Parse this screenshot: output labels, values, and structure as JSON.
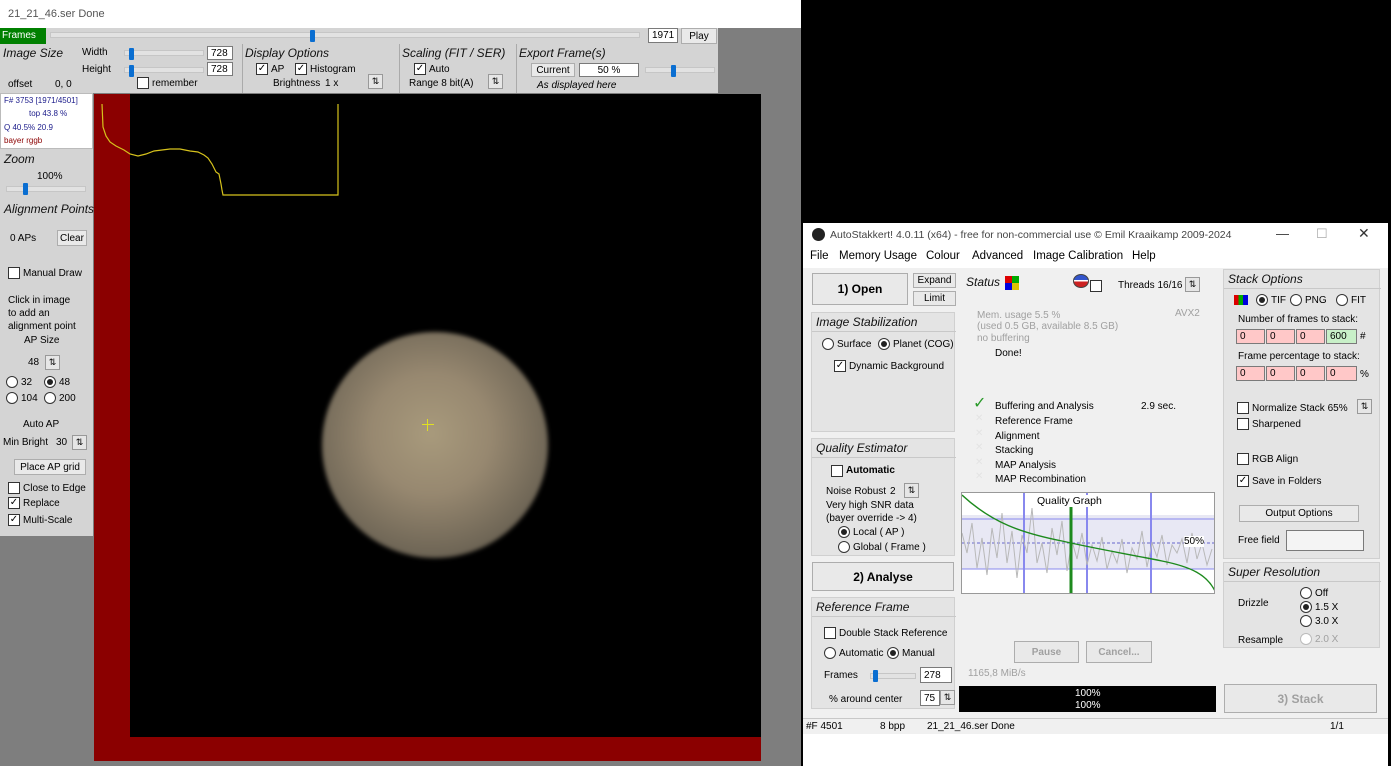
{
  "viewer": {
    "title": "21_21_46.ser   Done",
    "frames_label": "Frames",
    "frame_value": "1971",
    "frame_position": 0.44,
    "play_label": "Play",
    "image_size": {
      "title": "Image Size",
      "width_label": "Width",
      "width_value": "728",
      "height_label": "Height",
      "height_value": "728",
      "offset_label": "offset",
      "offset_value": "0, 0",
      "remember_label": "remember"
    },
    "display_options": {
      "title": "Display Options",
      "ap_label": "AP",
      "histogram_label": "Histogram",
      "brightness_label": "Brightness",
      "brightness_value": "1 x"
    },
    "scaling": {
      "title": "Scaling (FIT / SER)",
      "auto_label": "Auto",
      "range_label": "Range 8 bit(A)"
    },
    "export": {
      "title": "Export Frame(s)",
      "current_label": "Current",
      "percent_value": "50 %",
      "as_displayed": "As displayed here"
    },
    "info": {
      "frame_line": "F# 3753 [1971/4501]",
      "top_line": "top 43.8 %",
      "q_line": "Q 40.5%  20.9",
      "bayer_line": "bayer rggb"
    },
    "zoom": {
      "title": "Zoom",
      "value": "100%"
    },
    "alignment_points": {
      "title": "Alignment Points",
      "count": "0 APs",
      "clear_label": "Clear",
      "manual_draw": "Manual Draw",
      "hint_1": "Click in image",
      "hint_2": "to add an",
      "hint_3": "alignment point",
      "ap_size_label": "AP Size",
      "ap_size_value": "48",
      "sizes": [
        "32",
        "48",
        "104",
        "200"
      ],
      "auto_ap_label": "Auto AP",
      "min_bright_label": "Min Bright",
      "min_bright_value": "30",
      "place_grid_label": "Place AP grid",
      "close_to_edge": "Close to Edge",
      "replace": "Replace",
      "multi_scale": "Multi-Scale"
    }
  },
  "app": {
    "title": "AutoStakkert! 4.0.11 (x64) - free for non-commercial use © Emil Kraaikamp 2009-2024",
    "menu": [
      "File",
      "Memory Usage",
      "Colour",
      "Advanced",
      "Image Calibration",
      "Help"
    ],
    "open_label": "1) Open",
    "expand_label": "Expand",
    "limit_label": "Limit",
    "status": {
      "title": "Status",
      "threads": "Threads 16/16",
      "mem_line1": "Mem. usage 5.5 %",
      "mem_line2": "(used 0.5 GB, available 8.5 GB)",
      "mem_line3": "no buffering",
      "avx": "AVX2",
      "done": "Done!",
      "steps": [
        "Buffering and Analysis",
        "Reference Frame",
        "Alignment",
        "Stacking",
        "MAP Analysis",
        "MAP Recombination"
      ],
      "buffering_time": "2.9 sec.",
      "graph_title": "Quality Graph",
      "graph_pct": "50%",
      "pause_label": "Pause",
      "cancel_label": "Cancel...",
      "speed": "1165,8 MiB/s",
      "progress1": "100%",
      "progress2": "100%"
    },
    "stabilization": {
      "title": "Image Stabilization",
      "surface_label": "Surface",
      "planet_label": "Planet (COG)",
      "dynamic_bg_label": "Dynamic Background"
    },
    "quality": {
      "title": "Quality Estimator",
      "automatic_label": "Automatic",
      "noise_label": "Noise Robust",
      "noise_value": "2",
      "snr_line1": "Very high SNR data",
      "snr_line2": "(bayer override -> 4)",
      "local_label": "Local      ( AP )",
      "global_label": "Global      ( Frame )"
    },
    "analyse_label": "2) Analyse",
    "reference": {
      "title": "Reference Frame",
      "double_stack_label": "Double Stack Reference",
      "automatic_label": "Automatic",
      "manual_label": "Manual",
      "frames_label": "Frames",
      "frames_value": "278",
      "around_label": "% around center",
      "around_value": "75"
    },
    "stack_options": {
      "title": "Stack Options",
      "formats": [
        "TIF",
        "PNG",
        "FIT"
      ],
      "num_frames_label": "Number of frames to stack:",
      "num_frames_values": [
        "0",
        "0",
        "0",
        "600"
      ],
      "num_frames_unit": "#",
      "pct_label": "Frame percentage to stack:",
      "pct_values": [
        "0",
        "0",
        "0",
        "0"
      ],
      "pct_unit": "%",
      "normalize_label": "Normalize Stack 65%",
      "sharpened_label": "Sharpened",
      "rgb_align_label": "RGB Align",
      "save_folders_label": "Save in Folders",
      "output_options_label": "Output Options",
      "free_field_label": "Free field"
    },
    "super_resolution": {
      "title": "Super Resolution",
      "drizzle_label": "Drizzle",
      "drizzle_options": [
        "Off",
        "1.5 X",
        "3.0 X"
      ],
      "resample_label": "Resample",
      "resample_option": "2.0 X"
    },
    "stack_label": "3) Stack",
    "statusbar": {
      "frames": "#F 4501",
      "bpp": "8 bpp",
      "file": "21_21_46.ser  Done",
      "page": "1/1"
    },
    "colors": {
      "accent_green": "#008000",
      "red_field": "#ffc8c8",
      "green_field": "#c8f0c8",
      "viewer_red": "#8b0000"
    }
  }
}
